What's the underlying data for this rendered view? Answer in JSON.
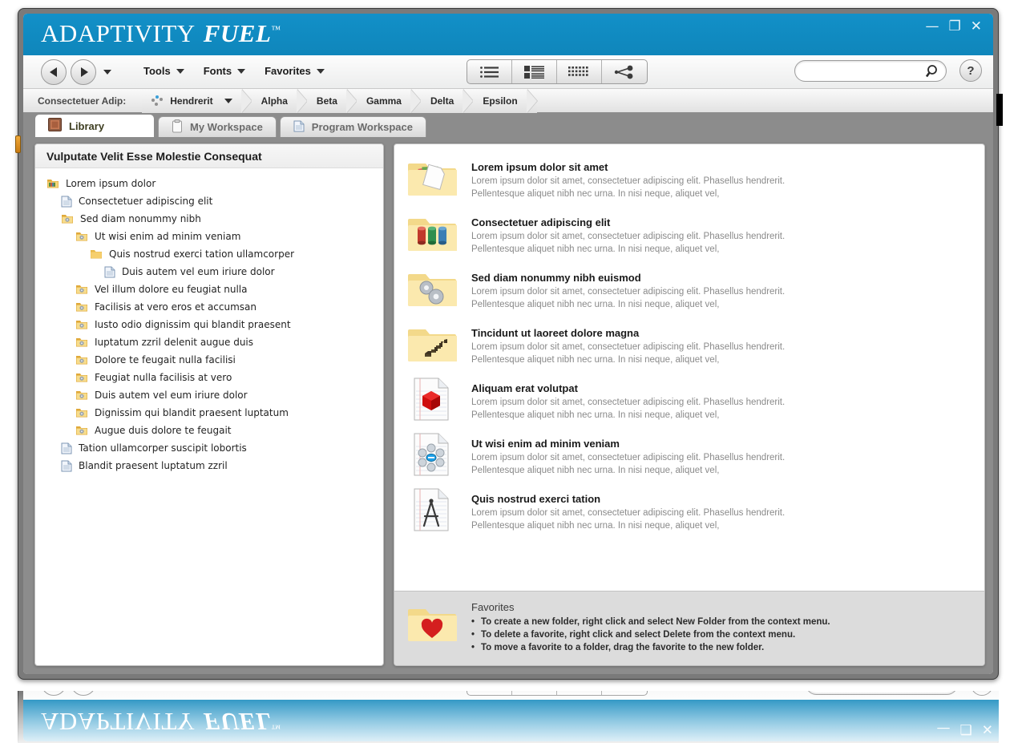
{
  "window": {
    "brand_primary": "ADAPTIVITY",
    "brand_secondary": "FUEL",
    "brand_tm": "™",
    "accent_color": "#1290c8",
    "minimize_label": "—",
    "maximize_label": "❐",
    "close_label": "✕"
  },
  "toolbar": {
    "back_label": "Back",
    "forward_label": "Forward",
    "history_label": "History",
    "menus": [
      {
        "label": "Tools"
      },
      {
        "label": "Fonts"
      },
      {
        "label": "Favorites"
      }
    ],
    "views": [
      {
        "name": "list-view"
      },
      {
        "name": "detail-view"
      },
      {
        "name": "grid-view"
      },
      {
        "name": "share-view"
      }
    ],
    "search_value": "",
    "search_placeholder": "",
    "help_label": "?"
  },
  "breadcrumb": {
    "prefix_label": "Consectetuer Adip:",
    "items": [
      {
        "label": "Hendrerit",
        "has_dots": true,
        "has_caret": true
      },
      {
        "label": "Alpha",
        "has_dots": false,
        "has_caret": false
      },
      {
        "label": "Beta",
        "has_dots": false,
        "has_caret": false
      },
      {
        "label": "Gamma",
        "has_dots": false,
        "has_caret": false
      },
      {
        "label": "Delta",
        "has_dots": false,
        "has_caret": false
      },
      {
        "label": "Epsilon",
        "has_dots": false,
        "has_caret": false
      }
    ]
  },
  "tabs": [
    {
      "label": "Library",
      "icon": "book-icon",
      "active": true
    },
    {
      "label": "My Workspace",
      "icon": "clipboard-icon",
      "active": false
    },
    {
      "label": "Program Workspace",
      "icon": "document-icon",
      "active": false
    }
  ],
  "tree": {
    "title": "Vulputate Velit Esse Molestie Consequat",
    "nodes": [
      {
        "label": "Lorem ipsum dolor",
        "depth": 0,
        "icon": "folder-library-icon"
      },
      {
        "label": "Consectetuer adipiscing elit",
        "depth": 1,
        "icon": "document-icon"
      },
      {
        "label": "Sed diam nonummy nibh",
        "depth": 1,
        "icon": "folder-gear-icon"
      },
      {
        "label": "Ut wisi enim ad minim veniam",
        "depth": 2,
        "icon": "folder-gear-icon"
      },
      {
        "label": "Quis nostrud exerci tation ullamcorper",
        "depth": 3,
        "icon": "folder-icon"
      },
      {
        "label": "Duis autem vel eum iriure dolor",
        "depth": 4,
        "icon": "document-icon"
      },
      {
        "label": "Vel illum dolore eu feugiat nulla",
        "depth": 2,
        "icon": "folder-gear-icon"
      },
      {
        "label": "Facilisis at vero eros et accumsan",
        "depth": 2,
        "icon": "folder-gear-icon"
      },
      {
        "label": "Iusto odio dignissim qui blandit praesent",
        "depth": 2,
        "icon": "folder-gear-icon"
      },
      {
        "label": "Iuptatum zzril delenit augue duis",
        "depth": 2,
        "icon": "folder-gear-icon"
      },
      {
        "label": "Dolore te feugait nulla facilisi",
        "depth": 2,
        "icon": "folder-gear-icon"
      },
      {
        "label": "Feugiat nulla facilisis at vero",
        "depth": 2,
        "icon": "folder-gear-icon"
      },
      {
        "label": "Duis autem vel eum iriure dolor",
        "depth": 2,
        "icon": "folder-gear-icon"
      },
      {
        "label": "Dignissim qui blandit praesent luptatum",
        "depth": 2,
        "icon": "folder-gear-icon"
      },
      {
        "label": "Augue duis dolore te feugait",
        "depth": 2,
        "icon": "folder-gear-icon"
      },
      {
        "label": "Tation ullamcorper suscipit lobortis",
        "depth": 1,
        "icon": "document-icon"
      },
      {
        "label": "Blandit praesent luptatum zzril",
        "depth": 1,
        "icon": "document-icon"
      }
    ]
  },
  "list": {
    "description": "Lorem ipsum dolor sit amet, consectetuer adipiscing elit. Phasellus hendrerit. Pellentesque aliquet nibh nec urna. In nisi neque, aliquet vel,",
    "items": [
      {
        "title": "Lorem ipsum dolor sit amet",
        "icon": "folder-papers-icon",
        "desc": "Lorem ipsum dolor sit amet, consectetuer adipiscing elit. Phasellus hendrerit. Pellentesque aliquet nibh nec urna. In nisi neque, aliquet vel,"
      },
      {
        "title": "Consectetuer adipiscing elit",
        "icon": "folder-database-icon",
        "desc": "Lorem ipsum dolor sit amet, consectetuer adipiscing elit. Phasellus hendrerit. Pellentesque aliquet nibh nec urna. In nisi neque, aliquet vel,"
      },
      {
        "title": "Sed diam nonummy nibh euismod",
        "icon": "folder-gears-icon",
        "desc": "Lorem ipsum dolor sit amet, consectetuer adipiscing elit. Phasellus hendrerit. Pellentesque aliquet nibh nec urna. In nisi neque, aliquet vel,"
      },
      {
        "title": "Tincidunt ut laoreet dolore magna",
        "icon": "folder-steps-icon",
        "desc": "Lorem ipsum dolor sit amet, consectetuer adipiscing elit. Phasellus hendrerit. Pellentesque aliquet nibh nec urna. In nisi neque, aliquet vel,"
      },
      {
        "title": "Aliquam erat volutpat",
        "icon": "document-cube-icon",
        "desc": "Lorem ipsum dolor sit amet, consectetuer adipiscing elit. Phasellus hendrerit. Pellentesque aliquet nibh nec urna. In nisi neque, aliquet vel,"
      },
      {
        "title": "Ut wisi enim ad minim veniam",
        "icon": "document-molecule-icon",
        "desc": "Lorem ipsum dolor sit amet, consectetuer adipiscing elit. Phasellus hendrerit. Pellentesque aliquet nibh nec urna. In nisi neque, aliquet vel,"
      },
      {
        "title": "Quis nostrud exerci tation",
        "icon": "document-compass-icon",
        "desc": "Lorem ipsum dolor sit amet, consectetuer adipiscing elit. Phasellus hendrerit. Pellentesque aliquet nibh nec urna. In nisi neque, aliquet vel,"
      }
    ]
  },
  "favorites": {
    "title": "Favorites",
    "icon": "folder-heart-icon",
    "tips": [
      "To create a new folder, right click and select New Folder from the context menu.",
      "To delete a favorite, right click and select Delete from the context menu.",
      "To move a favorite to a folder, drag the favorite to the new folder."
    ]
  }
}
